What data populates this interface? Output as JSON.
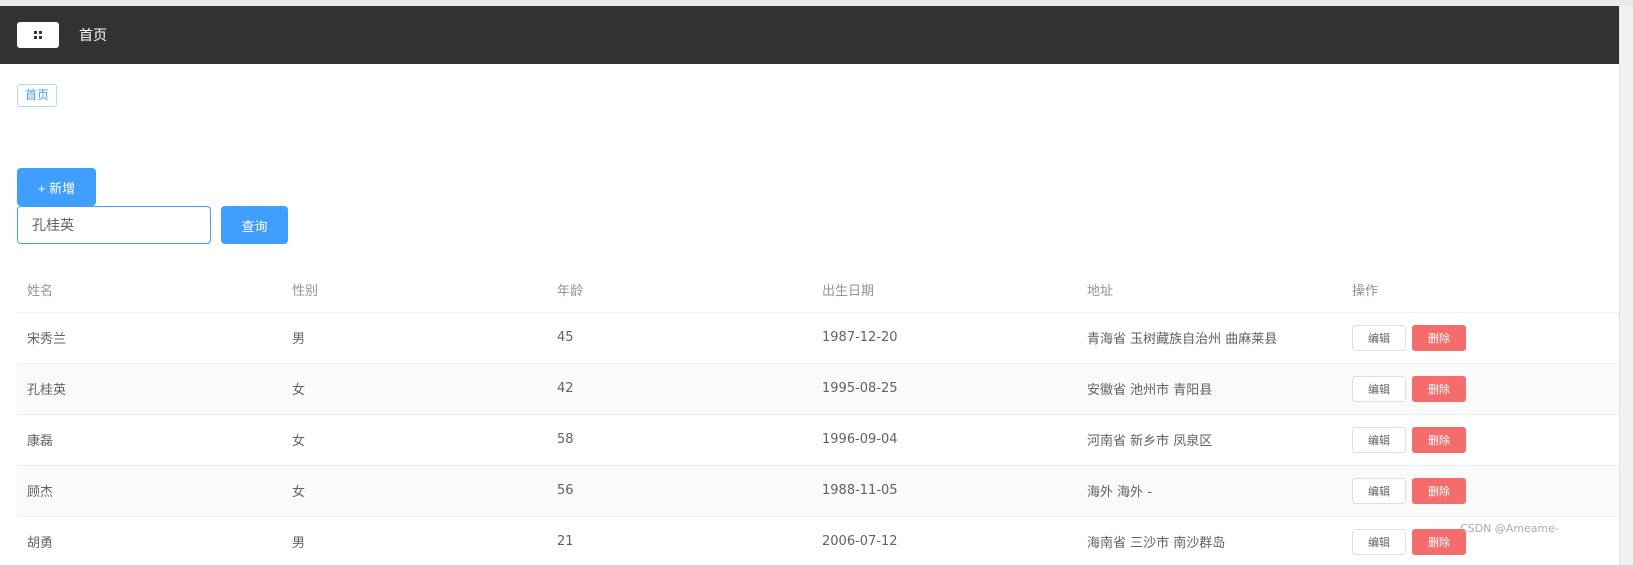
{
  "navbar": {
    "title": "首页",
    "menu_icon": "grid-icon"
  },
  "breadcrumb": {
    "label": "首页"
  },
  "toolbar": {
    "add_label": "+ 新增",
    "search_value": "孔桂英",
    "query_label": "查询"
  },
  "table": {
    "headers": [
      "姓名",
      "性别",
      "年龄",
      "出生日期",
      "地址",
      "操作"
    ],
    "rows": [
      {
        "name": "宋秀兰",
        "gender": "男",
        "age": "45",
        "birth": "1987-12-20",
        "address": "青海省 玉树藏族自治州 曲麻莱县"
      },
      {
        "name": "孔桂英",
        "gender": "女",
        "age": "42",
        "birth": "1995-08-25",
        "address": "安徽省 池州市 青阳县"
      },
      {
        "name": "康磊",
        "gender": "女",
        "age": "58",
        "birth": "1996-09-04",
        "address": "河南省 新乡市 凤泉区"
      },
      {
        "name": "顾杰",
        "gender": "女",
        "age": "56",
        "birth": "1988-11-05",
        "address": "海外 海外 -"
      },
      {
        "name": "胡勇",
        "gender": "男",
        "age": "21",
        "birth": "2006-07-12",
        "address": "海南省 三沙市 南沙群岛"
      }
    ],
    "edit_label": "编辑",
    "delete_label": "删除"
  },
  "watermark": "CSDN @Ameame-",
  "colors": {
    "primary": "#409eff",
    "danger": "#f56c6c",
    "navbar": "#333333"
  }
}
